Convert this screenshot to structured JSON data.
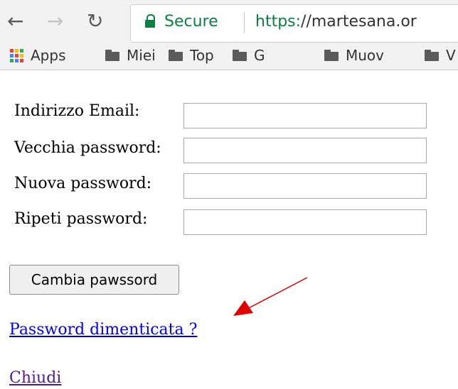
{
  "browser": {
    "security_label": "Secure",
    "url_scheme": "https:",
    "url_rest": "//martesana.or",
    "bookmarks": [
      {
        "label": "Apps"
      },
      {
        "label": "Miei"
      },
      {
        "label": "Top"
      },
      {
        "label": "G"
      },
      {
        "label": "Muov"
      },
      {
        "label": "V"
      }
    ],
    "colors": {
      "secure": "#0b8043"
    }
  },
  "form": {
    "email_label": "Indirizzo Email:",
    "old_password_label": "Vecchia password:",
    "new_password_label": "Nuova password:",
    "repeat_password_label": "Ripeti password:",
    "email_value": "",
    "old_password_value": "",
    "new_password_value": "",
    "repeat_password_value": "",
    "submit_label": "Cambia pawssord"
  },
  "links": {
    "forgot_password": "Password dimenticata ?",
    "close": "Chiudi"
  },
  "annotation": {
    "color": "#e00000"
  }
}
